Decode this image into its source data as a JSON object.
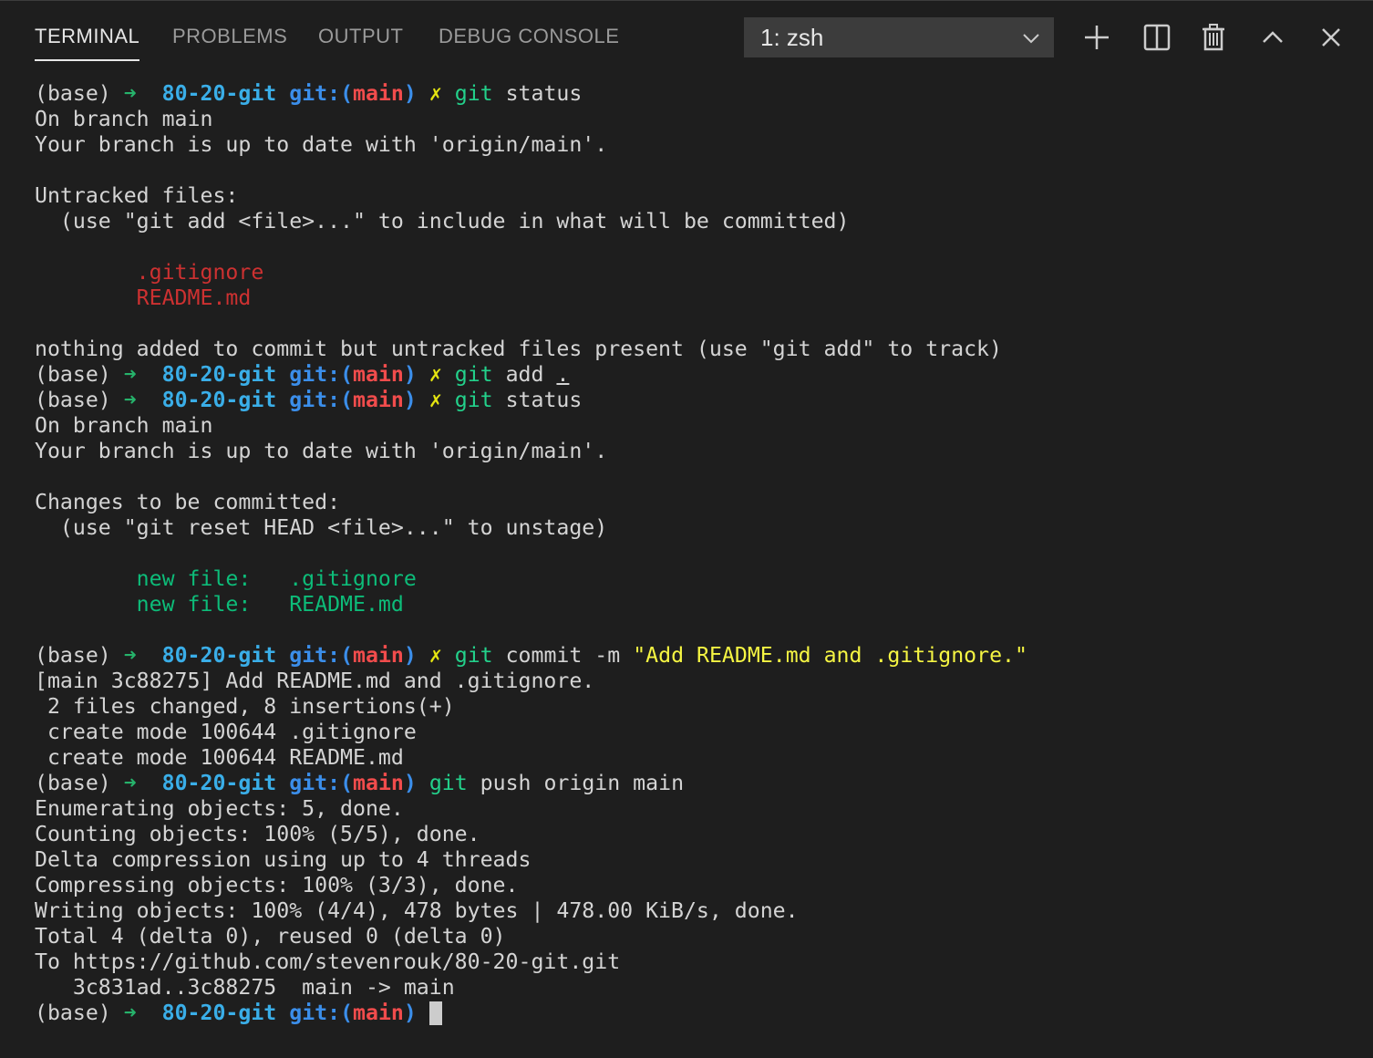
{
  "tabs": [
    {
      "label": "TERMINAL",
      "active": true
    },
    {
      "label": "PROBLEMS",
      "active": false
    },
    {
      "label": "OUTPUT",
      "active": false
    },
    {
      "label": "DEBUG CONSOLE",
      "active": false
    }
  ],
  "terminal_select": {
    "value": "1: zsh"
  },
  "actions": [
    {
      "name": "new-terminal",
      "icon": "plus-icon"
    },
    {
      "name": "split-terminal",
      "icon": "split-icon"
    },
    {
      "name": "kill-terminal",
      "icon": "trash-icon"
    },
    {
      "name": "maximize-panel",
      "icon": "chevron-up-icon"
    },
    {
      "name": "close-panel",
      "icon": "close-icon"
    }
  ],
  "colors": {
    "background": "#1e1e1e",
    "arrow": "#26b36b",
    "directory": "#3aaee8",
    "git_label": "#3b8eea",
    "branch": "#f14c4c",
    "dirty_mark": "#e5e510",
    "command": "#23d18b",
    "string": "#f5f543",
    "untracked": "#cd3131",
    "staged": "#0dbc79"
  },
  "terminal": {
    "lines": [
      [
        {
          "t": "(base) ",
          "c": "c-default"
        },
        {
          "t": "➜  ",
          "c": "c-arrow"
        },
        {
          "t": "80-20-git ",
          "c": "c-dir"
        },
        {
          "t": "git:(",
          "c": "c-gitlabel"
        },
        {
          "t": "main",
          "c": "c-branch"
        },
        {
          "t": ") ",
          "c": "c-gitlabel"
        },
        {
          "t": "✗ ",
          "c": "c-x"
        },
        {
          "t": "git",
          "c": "c-cmd"
        },
        {
          "t": " status",
          "c": "c-default"
        }
      ],
      [
        {
          "t": "On branch main",
          "c": "c-default"
        }
      ],
      [
        {
          "t": "Your branch is up to date with 'origin/main'.",
          "c": "c-default"
        }
      ],
      [],
      [
        {
          "t": "Untracked files:",
          "c": "c-default"
        }
      ],
      [
        {
          "t": "  (use \"git add <file>...\" to include in what will be committed)",
          "c": "c-default"
        }
      ],
      [],
      [
        {
          "t": "        .gitignore",
          "c": "c-red"
        }
      ],
      [
        {
          "t": "        README.md",
          "c": "c-red"
        }
      ],
      [],
      [
        {
          "t": "nothing added to commit but untracked files present (use \"git add\" to track)",
          "c": "c-default"
        }
      ],
      [
        {
          "t": "(base) ",
          "c": "c-default"
        },
        {
          "t": "➜  ",
          "c": "c-arrow"
        },
        {
          "t": "80-20-git ",
          "c": "c-dir"
        },
        {
          "t": "git:(",
          "c": "c-gitlabel"
        },
        {
          "t": "main",
          "c": "c-branch"
        },
        {
          "t": ") ",
          "c": "c-gitlabel"
        },
        {
          "t": "✗ ",
          "c": "c-x"
        },
        {
          "t": "git",
          "c": "c-cmd"
        },
        {
          "t": " add ",
          "c": "c-default"
        },
        {
          "t": ".",
          "c": "c-default u"
        }
      ],
      [
        {
          "t": "(base) ",
          "c": "c-default"
        },
        {
          "t": "➜  ",
          "c": "c-arrow"
        },
        {
          "t": "80-20-git ",
          "c": "c-dir"
        },
        {
          "t": "git:(",
          "c": "c-gitlabel"
        },
        {
          "t": "main",
          "c": "c-branch"
        },
        {
          "t": ") ",
          "c": "c-gitlabel"
        },
        {
          "t": "✗ ",
          "c": "c-x"
        },
        {
          "t": "git",
          "c": "c-cmd"
        },
        {
          "t": " status",
          "c": "c-default"
        }
      ],
      [
        {
          "t": "On branch main",
          "c": "c-default"
        }
      ],
      [
        {
          "t": "Your branch is up to date with 'origin/main'.",
          "c": "c-default"
        }
      ],
      [],
      [
        {
          "t": "Changes to be committed:",
          "c": "c-default"
        }
      ],
      [
        {
          "t": "  (use \"git reset HEAD <file>...\" to unstage)",
          "c": "c-default"
        }
      ],
      [],
      [
        {
          "t": "        new file:   .gitignore",
          "c": "c-green"
        }
      ],
      [
        {
          "t": "        new file:   README.md",
          "c": "c-green"
        }
      ],
      [],
      [
        {
          "t": "(base) ",
          "c": "c-default"
        },
        {
          "t": "➜  ",
          "c": "c-arrow"
        },
        {
          "t": "80-20-git ",
          "c": "c-dir"
        },
        {
          "t": "git:(",
          "c": "c-gitlabel"
        },
        {
          "t": "main",
          "c": "c-branch"
        },
        {
          "t": ") ",
          "c": "c-gitlabel"
        },
        {
          "t": "✗ ",
          "c": "c-x"
        },
        {
          "t": "git",
          "c": "c-cmd"
        },
        {
          "t": " commit -m ",
          "c": "c-default"
        },
        {
          "t": "\"Add README.md and .gitignore.\"",
          "c": "c-str"
        }
      ],
      [
        {
          "t": "[main 3c88275] Add README.md and .gitignore.",
          "c": "c-default"
        }
      ],
      [
        {
          "t": " 2 files changed, 8 insertions(+)",
          "c": "c-default"
        }
      ],
      [
        {
          "t": " create mode 100644 .gitignore",
          "c": "c-default"
        }
      ],
      [
        {
          "t": " create mode 100644 README.md",
          "c": "c-default"
        }
      ],
      [
        {
          "t": "(base) ",
          "c": "c-default"
        },
        {
          "t": "➜  ",
          "c": "c-arrow"
        },
        {
          "t": "80-20-git ",
          "c": "c-dir"
        },
        {
          "t": "git:(",
          "c": "c-gitlabel"
        },
        {
          "t": "main",
          "c": "c-branch"
        },
        {
          "t": ") ",
          "c": "c-gitlabel"
        },
        {
          "t": "git",
          "c": "c-cmd"
        },
        {
          "t": " push origin main",
          "c": "c-default"
        }
      ],
      [
        {
          "t": "Enumerating objects: 5, done.",
          "c": "c-default"
        }
      ],
      [
        {
          "t": "Counting objects: 100% (5/5), done.",
          "c": "c-default"
        }
      ],
      [
        {
          "t": "Delta compression using up to 4 threads",
          "c": "c-default"
        }
      ],
      [
        {
          "t": "Compressing objects: 100% (3/3), done.",
          "c": "c-default"
        }
      ],
      [
        {
          "t": "Writing objects: 100% (4/4), 478 bytes | 478.00 KiB/s, done.",
          "c": "c-default"
        }
      ],
      [
        {
          "t": "Total 4 (delta 0), reused 0 (delta 0)",
          "c": "c-default"
        }
      ],
      [
        {
          "t": "To https://github.com/stevenrouk/80-20-git.git",
          "c": "c-default"
        }
      ],
      [
        {
          "t": "   3c831ad..3c88275  main -> main",
          "c": "c-default"
        }
      ],
      [
        {
          "t": "(base) ",
          "c": "c-default"
        },
        {
          "t": "➜  ",
          "c": "c-arrow"
        },
        {
          "t": "80-20-git ",
          "c": "c-dir"
        },
        {
          "t": "git:(",
          "c": "c-gitlabel"
        },
        {
          "t": "main",
          "c": "c-branch"
        },
        {
          "t": ") ",
          "c": "c-gitlabel"
        }
      ]
    ]
  }
}
